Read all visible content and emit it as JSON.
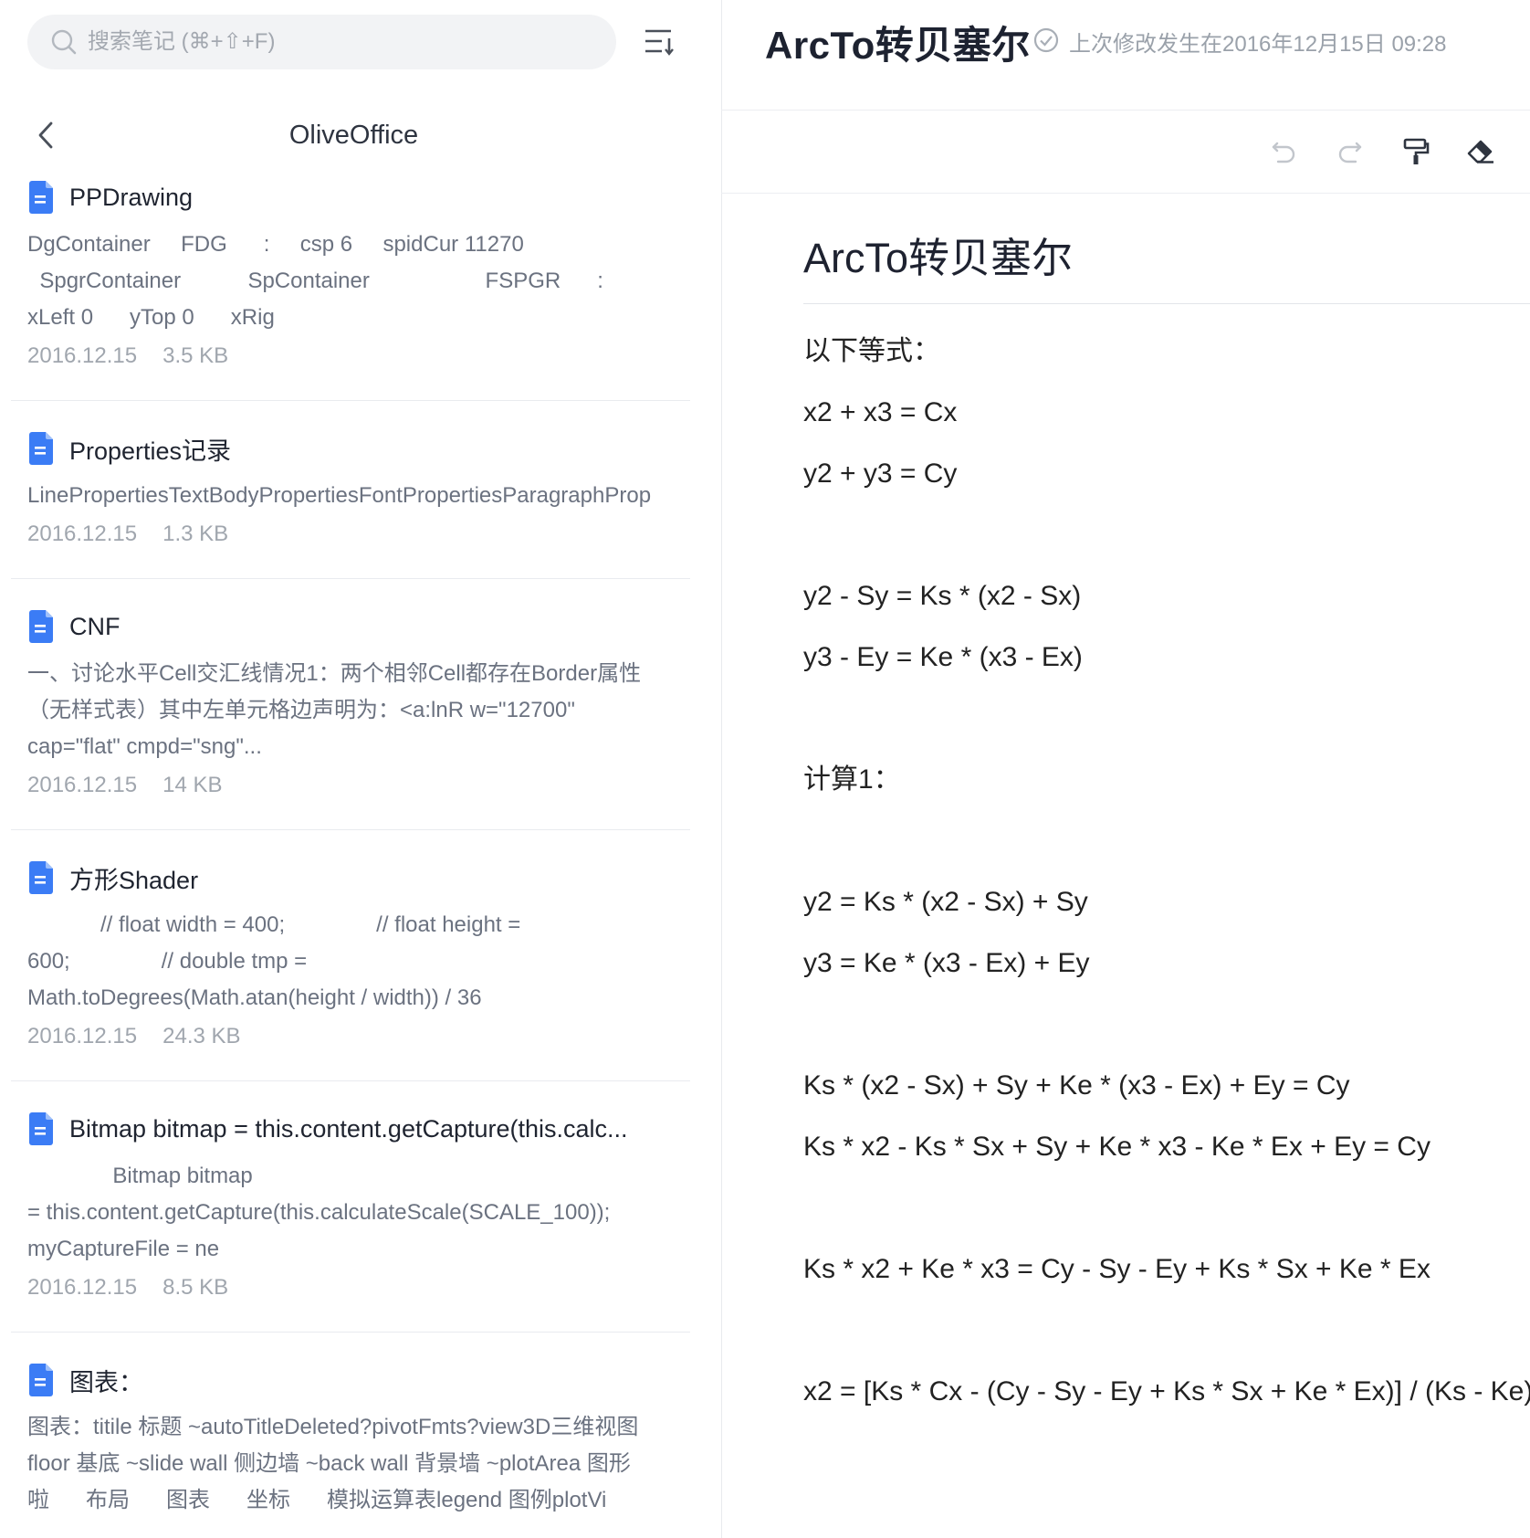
{
  "search": {
    "placeholder": "搜索笔记 (⌘+⇧+F)"
  },
  "folder": {
    "title": "OliveOffice"
  },
  "notes": [
    {
      "title": "PPDrawing",
      "preview": "DgContainer     FDG      :     csp 6     spidCur 11270\n  SpgrContainer           SpContainer                   FSPGR      :\nxLeft 0      yTop 0      xRig",
      "date": "2016.12.15",
      "size": "3.5 KB"
    },
    {
      "title": "Properties记录",
      "preview": "LinePropertiesTextBodyPropertiesFontPropertiesParagraphProp",
      "date": "2016.12.15",
      "size": "1.3 KB"
    },
    {
      "title": "CNF",
      "preview": "一、讨论水平Cell交汇线情况1：两个相邻Cell都存在Border属性\n（无样式表）其中左单元格边声明为：<a:lnR w=\"12700\"\ncap=\"flat\" cmpd=\"sng\"...",
      "date": "2016.12.15",
      "size": "14 KB"
    },
    {
      "title": "方形Shader",
      "preview": "            // float width = 400;               // float height =\n600;               // double tmp =\nMath.toDegrees(Math.atan(height / width)) / 36",
      "date": "2016.12.15",
      "size": "24.3 KB"
    },
    {
      "title": "Bitmap bitmap = this.content.getCapture(this.calc...",
      "preview": "              Bitmap bitmap\n= this.content.getCapture(this.calculateScale(SCALE_100));\nmyCaptureFile = ne",
      "date": "2016.12.15",
      "size": "8.5 KB"
    },
    {
      "title": "图表：",
      "preview": "图表：titile 标题 ~autoTitleDeleted?pivotFmts?view3D三维视图\nfloor 基底 ~slide wall 侧边墙 ~back wall 背景墙 ~plotArea 图形\n啦      布局      图表      坐标      模拟运算表legend 图例plotVi",
      "date": "",
      "size": ""
    }
  ],
  "document": {
    "header_title": "ArcTo转贝塞尔",
    "saved_text": "上次修改发生在2016年12月15日 09:28",
    "title": "ArcTo转贝塞尔",
    "lines": [
      "以下等式：",
      "x2 + x3 = Cx",
      "y2 + y3 = Cy",
      "",
      "y2 - Sy = Ks * (x2 - Sx)",
      "y3 - Ey = Ke * (x3 - Ex)",
      "",
      "计算1：",
      "",
      "y2 = Ks * (x2 - Sx) + Sy",
      "y3 = Ke * (x3 - Ex) + Ey",
      "",
      "Ks * (x2 - Sx) + Sy + Ke * (x3 - Ex) + Ey = Cy",
      "Ks * x2 - Ks * Sx + Sy + Ke * x3 - Ke * Ex + Ey = Cy",
      "",
      "Ks * x2 + Ke * x3 = Cy - Sy - Ey + Ks * Sx + Ke * Ex",
      "",
      "x2 = [Ks * Cx - (Cy - Sy - Ey + Ks * Sx + Ke * Ex)] / (Ks - Ke)"
    ]
  },
  "toolbar": {
    "icons": [
      "undo-icon",
      "redo-icon",
      "format-painter-icon",
      "eraser-icon"
    ]
  },
  "colors": {
    "accent": "#3b7cf5",
    "icon_gray": "#8a9098",
    "text": "#222222"
  }
}
